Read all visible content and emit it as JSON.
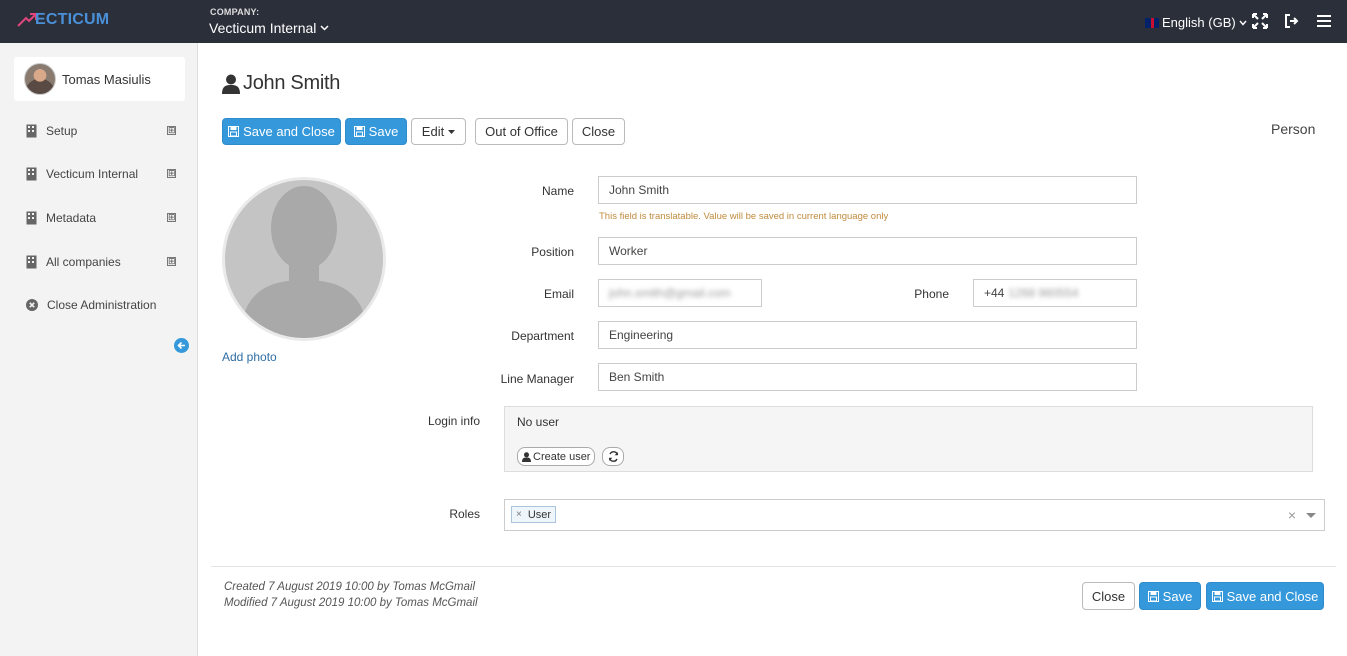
{
  "header": {
    "logo_text": "ECTICUM",
    "company_label": "COMPANY:",
    "company_name": "Vecticum Internal",
    "language": "English (GB)"
  },
  "sidebar": {
    "user_name": "Tomas Masiulis",
    "items": [
      {
        "label": "Setup"
      },
      {
        "label": "Vecticum Internal"
      },
      {
        "label": "Metadata"
      },
      {
        "label": "All companies"
      },
      {
        "label": "Close Administration"
      }
    ],
    "expand_glyph": "⊞"
  },
  "page": {
    "title": "John Smith",
    "type_label": "Person",
    "toolbar": {
      "save_and_close": "Save and Close",
      "save": "Save",
      "edit": "Edit",
      "out_of_office": "Out of Office",
      "close": "Close"
    },
    "add_photo": "Add photo"
  },
  "form": {
    "name_label": "Name",
    "name_value": "John Smith",
    "name_hint": "This field is translatable. Value will be saved in current language only",
    "position_label": "Position",
    "position_value": "Worker",
    "email_label": "Email",
    "email_value": "john.smith@gmail.com",
    "phone_label": "Phone",
    "phone_prefix": "+44",
    "phone_rest": "1268 960554",
    "department_label": "Department",
    "department_value": "Engineering",
    "line_manager_label": "Line Manager",
    "line_manager_value": "Ben Smith",
    "login_info_label": "Login info",
    "login_status": "No user",
    "create_user": "Create user",
    "roles_label": "Roles",
    "roles": [
      "User"
    ],
    "tag_remove": "×",
    "clear": "×"
  },
  "footer": {
    "created": "Created 7 August 2019 10:00 by Tomas McGmail",
    "modified": "Modified 7 August 2019 10:00 by Tomas McGmail",
    "close": "Close",
    "save": "Save",
    "save_and_close": "Save and Close"
  },
  "colors": {
    "topbar": "#2b2f3a",
    "primary": "#3498db",
    "logo": "#4a90d9",
    "hint": "#c08b3e"
  }
}
